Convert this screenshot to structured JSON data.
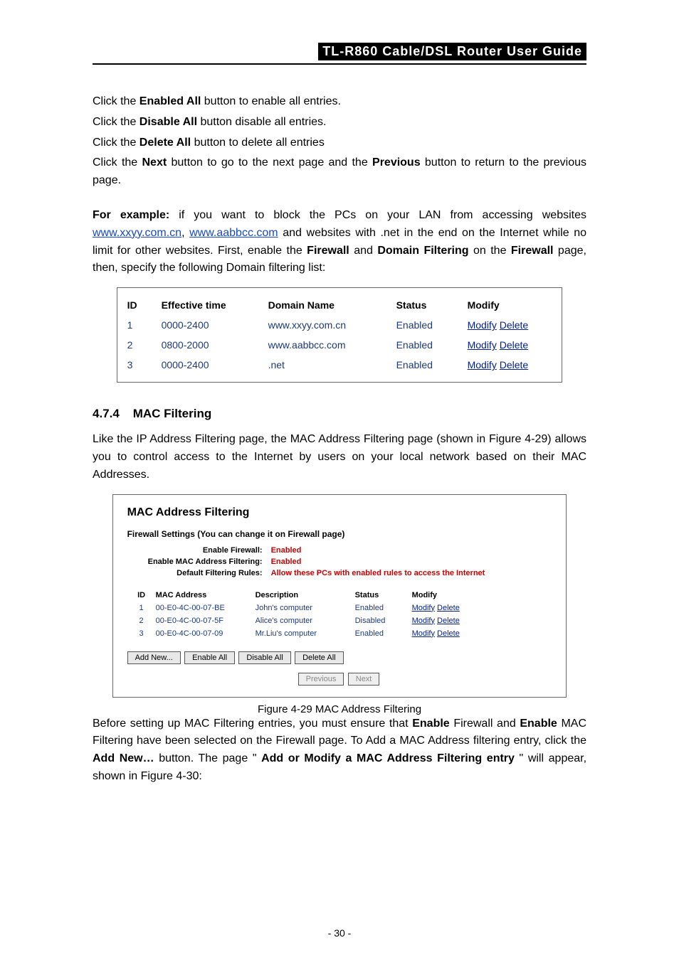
{
  "header": {
    "title": "TL-R860  Cable/DSL Router User Guide"
  },
  "intro": {
    "l1a": "Click the ",
    "l1b": "Enabled All",
    "l1c": " button to enable all entries.",
    "l2a": "Click the ",
    "l2b": "Disable All",
    "l2c": " button disable all entries.",
    "l3a": "Click the ",
    "l3b": "Delete All",
    "l3c": " button to delete all entries",
    "l4a": "Click the ",
    "l4b": "Next",
    "l4c": " button to go to the next page and the ",
    "l4d": "Previous",
    "l4e": " button to return to the previous page."
  },
  "example": {
    "lead": "For example:",
    "t1": " if you want to block the PCs on your LAN from accessing websites ",
    "link1": "www.xxyy.com.cn",
    "t2": ", ",
    "link2": "www.aabbcc.com",
    "t3": " and websites with .net in the end on the Internet while no limit for other websites. First, enable the ",
    "b1": "Firewall",
    "t4": " and ",
    "b2": "Domain Filtering",
    "t5": " on the ",
    "b3": "Firewall",
    "t6": " page, then, specify the following Domain filtering list:"
  },
  "figtable": {
    "head": {
      "id": "ID",
      "time": "Effective time",
      "dom": "Domain Name",
      "stat": "Status",
      "mod": "Modify"
    },
    "rows": [
      {
        "id": "1",
        "time": "0000-2400",
        "dom": "www.xxyy.com.cn",
        "stat": "Enabled",
        "mod1": "Modify",
        "mod2": "Delete"
      },
      {
        "id": "2",
        "time": "0800-2000",
        "dom": "www.aabbcc.com",
        "stat": "Enabled",
        "mod1": "Modify",
        "mod2": "Delete"
      },
      {
        "id": "3",
        "time": "0000-2400",
        "dom": ".net",
        "stat": "Enabled",
        "mod1": "Modify",
        "mod2": "Delete"
      }
    ]
  },
  "section": {
    "num": "4.7.4",
    "title": "MAC Filtering"
  },
  "macintro": "Like the IP Address Filtering page, the MAC Address Filtering page (shown in Figure 4-29) allows you to control access to the Internet by users on your local network based on their MAC Addresses.",
  "macbox": {
    "title": "MAC Address Filtering",
    "sub": "Firewall Settings (You can change it on Firewall page)",
    "settings": [
      {
        "label": "Enable Firewall:",
        "val": "Enabled"
      },
      {
        "label": "Enable MAC Address Filtering:",
        "val": "Enabled"
      },
      {
        "label": "Default Filtering Rules:",
        "val": "Allow these PCs with enabled rules to access the Internet"
      }
    ],
    "thead": {
      "id": "ID",
      "mac": "MAC Address",
      "desc": "Description",
      "stat": "Status",
      "mod": "Modify"
    },
    "rows": [
      {
        "id": "1",
        "mac": "00-E0-4C-00-07-BE",
        "desc": "John's computer",
        "stat": "Enabled",
        "m1": "Modify",
        "m2": "Delete"
      },
      {
        "id": "2",
        "mac": "00-E0-4C-00-07-5F",
        "desc": "Alice's computer",
        "stat": "Disabled",
        "m1": "Modify",
        "m2": "Delete"
      },
      {
        "id": "3",
        "mac": "00-E0-4C-00-07-09",
        "desc": "Mr.Liu's computer",
        "stat": "Enabled",
        "m1": "Modify",
        "m2": "Delete"
      }
    ],
    "buttons": {
      "addnew": "Add New...",
      "enable": "Enable All",
      "disable": "Disable All",
      "delete": "Delete All",
      "prev": "Previous",
      "next": "Next"
    }
  },
  "figcaption": "Figure 4-29 MAC Address Filtering",
  "outro": {
    "t1": "Before setting up MAC Filtering entries, you must ensure that ",
    "b1": "Enable",
    "t2": " Firewall and ",
    "b2": "Enable",
    "t3": " MAC Filtering have been selected on the Firewall page. To Add a MAC Address filtering entry, click the ",
    "b3": "Add New…",
    "t4": " button. The page \" ",
    "b4": "Add or Modify a MAC Address Filtering entry",
    "t5": "\" will appear, shown in Figure 4-30:"
  },
  "pagenum": "- 30 -"
}
